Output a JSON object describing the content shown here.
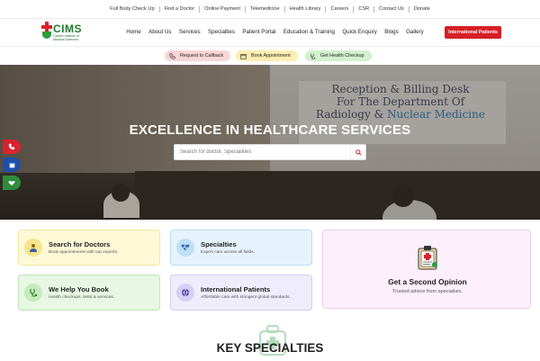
{
  "topbar": {
    "links": [
      "Full Body Check Up",
      "Find a Doctor",
      "Online Payment",
      "Telemedicine",
      "Health Library",
      "Careers",
      "CSR",
      "Contact Us",
      "Donate"
    ]
  },
  "logo": {
    "name": "CIMS",
    "sub": "Caretel Institute of Medical Sciences"
  },
  "nav": {
    "items": [
      "Home",
      "About Us",
      "Services",
      "Specialties",
      "Patient Portal",
      "Education & Training",
      "Quick Enquiry",
      "Blogs",
      "Gallery"
    ],
    "cta": "International Patients"
  },
  "pills": {
    "callback": "Request to Callback",
    "appointment": "Book Appointment",
    "checkup": "Get Health Checkup"
  },
  "hero": {
    "title": "EXCELLENCE IN HEALTHCARE SERVICES",
    "sign_line1": "Reception & Billing Desk",
    "sign_line2": "For The Department Of",
    "sign_line3a": "Radiology & ",
    "sign_line3b": "Nuclear Medicine",
    "search_placeholder": "Search for doctor, Specialities"
  },
  "cards": {
    "search_doctors": {
      "title": "Search for Doctors",
      "sub": "Book appointments with top experts."
    },
    "specialties": {
      "title": "Specialties",
      "sub": "Expert care across all fields."
    },
    "help_book": {
      "title": "We Help You Book",
      "sub": "Health checkups, tests & services."
    },
    "international": {
      "title": "International Patients",
      "sub": "Affordable care with stringent global standards."
    },
    "second_opinion": {
      "title": "Get a Second Opinion",
      "sub": "Trusted advice from specialists."
    }
  },
  "section": {
    "title": "KEY SPECIALTIES"
  },
  "colors": {
    "brand_red": "#d61f26",
    "brand_green": "#1f7a2e"
  }
}
